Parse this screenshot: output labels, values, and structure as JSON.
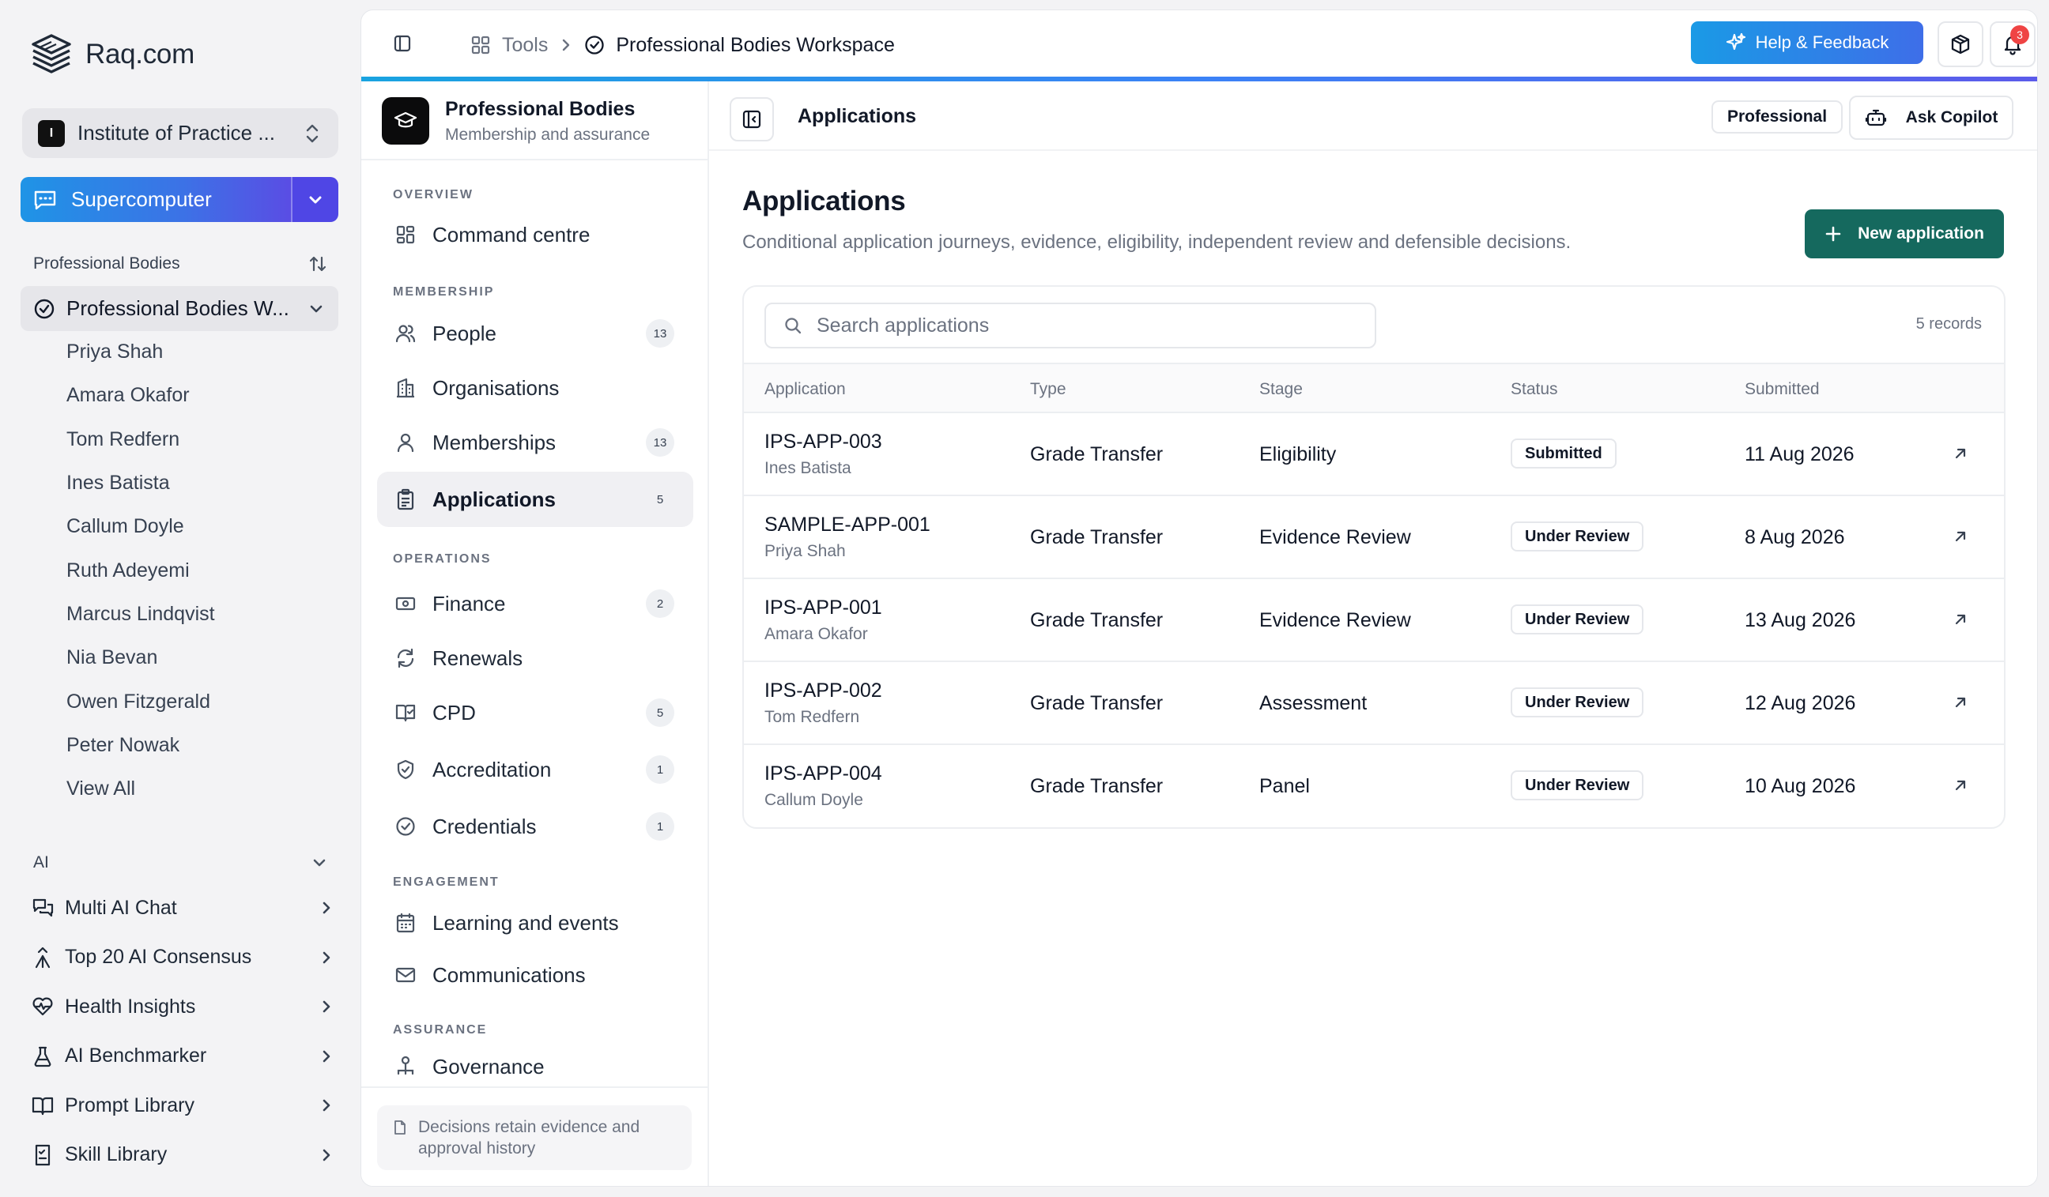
{
  "app": {
    "brand": "Raq.com",
    "org_switcher": {
      "badge": "I",
      "name": "Institute of Practice ..."
    },
    "supercomputer_label": "Supercomputer",
    "workspace_section": {
      "title": "Professional Bodies",
      "active_item": "Professional Bodies W..."
    },
    "people": [
      "Priya Shah",
      "Amara Okafor",
      "Tom Redfern",
      "Ines Batista",
      "Callum Doyle",
      "Ruth Adeyemi",
      "Marcus Lindqvist",
      "Nia Bevan",
      "Owen Fitzgerald",
      "Peter Nowak",
      "View All"
    ],
    "ai_section": {
      "title": "AI"
    },
    "ai_items": [
      {
        "label": "Multi AI Chat",
        "icon": "chat-icon"
      },
      {
        "label": "Top 20 AI Consensus",
        "icon": "merge-icon"
      },
      {
        "label": "Health Insights",
        "icon": "heart-pulse-icon"
      },
      {
        "label": "AI Benchmarker",
        "icon": "flask-icon"
      },
      {
        "label": "Prompt Library",
        "icon": "book-icon"
      },
      {
        "label": "Skill Library",
        "icon": "checklist-icon"
      }
    ]
  },
  "topbar": {
    "breadcrumb_tools": "Tools",
    "breadcrumb_current": "Professional Bodies Workspace",
    "help_label": "Help & Feedback",
    "notification_count": "3"
  },
  "module": {
    "title": "Professional Bodies",
    "subtitle": "Membership and assurance",
    "groups": {
      "overview": "OVERVIEW",
      "membership": "MEMBERSHIP",
      "operations": "OPERATIONS",
      "engagement": "ENGAGEMENT",
      "assurance": "ASSURANCE"
    },
    "nav": {
      "command_centre": {
        "label": "Command centre"
      },
      "people": {
        "label": "People",
        "count": "13"
      },
      "organisations": {
        "label": "Organisations"
      },
      "memberships": {
        "label": "Memberships",
        "count": "13"
      },
      "applications": {
        "label": "Applications",
        "count": "5"
      },
      "finance": {
        "label": "Finance",
        "count": "2"
      },
      "renewals": {
        "label": "Renewals"
      },
      "cpd": {
        "label": "CPD",
        "count": "5"
      },
      "accreditation": {
        "label": "Accreditation",
        "count": "1"
      },
      "credentials": {
        "label": "Credentials",
        "count": "1"
      },
      "learning": {
        "label": "Learning and events"
      },
      "communications": {
        "label": "Communications"
      },
      "governance": {
        "label": "Governance"
      }
    },
    "footer_note": "Decisions retain evidence and approval history"
  },
  "content": {
    "bar_title": "Applications",
    "tier_pill": "Professional",
    "copilot_label": "Ask Copilot",
    "page_title": "Applications",
    "page_description": "Conditional application journeys, evidence, eligibility, independent review and defensible decisions.",
    "new_button": "New application",
    "search_placeholder": "Search applications",
    "records": "5 records",
    "columns": [
      "Application",
      "Type",
      "Stage",
      "Status",
      "Submitted"
    ],
    "rows": [
      {
        "id": "IPS-APP-003",
        "person": "Ines Batista",
        "type": "Grade Transfer",
        "stage": "Eligibility",
        "status": "Submitted",
        "submitted": "11 Aug 2026"
      },
      {
        "id": "SAMPLE-APP-001",
        "person": "Priya Shah",
        "type": "Grade Transfer",
        "stage": "Evidence Review",
        "status": "Under Review",
        "submitted": "8 Aug 2026"
      },
      {
        "id": "IPS-APP-001",
        "person": "Amara Okafor",
        "type": "Grade Transfer",
        "stage": "Evidence Review",
        "status": "Under Review",
        "submitted": "13 Aug 2026"
      },
      {
        "id": "IPS-APP-002",
        "person": "Tom Redfern",
        "type": "Grade Transfer",
        "stage": "Assessment",
        "status": "Under Review",
        "submitted": "12 Aug 2026"
      },
      {
        "id": "IPS-APP-004",
        "person": "Callum Doyle",
        "type": "Grade Transfer",
        "stage": "Panel",
        "status": "Under Review",
        "submitted": "10 Aug 2026"
      }
    ]
  },
  "colors": {
    "accent_gradient_start": "#1f94e6",
    "accent_gradient_end": "#5a4de4",
    "primary_button": "#15695e",
    "notification": "#ef4444"
  }
}
